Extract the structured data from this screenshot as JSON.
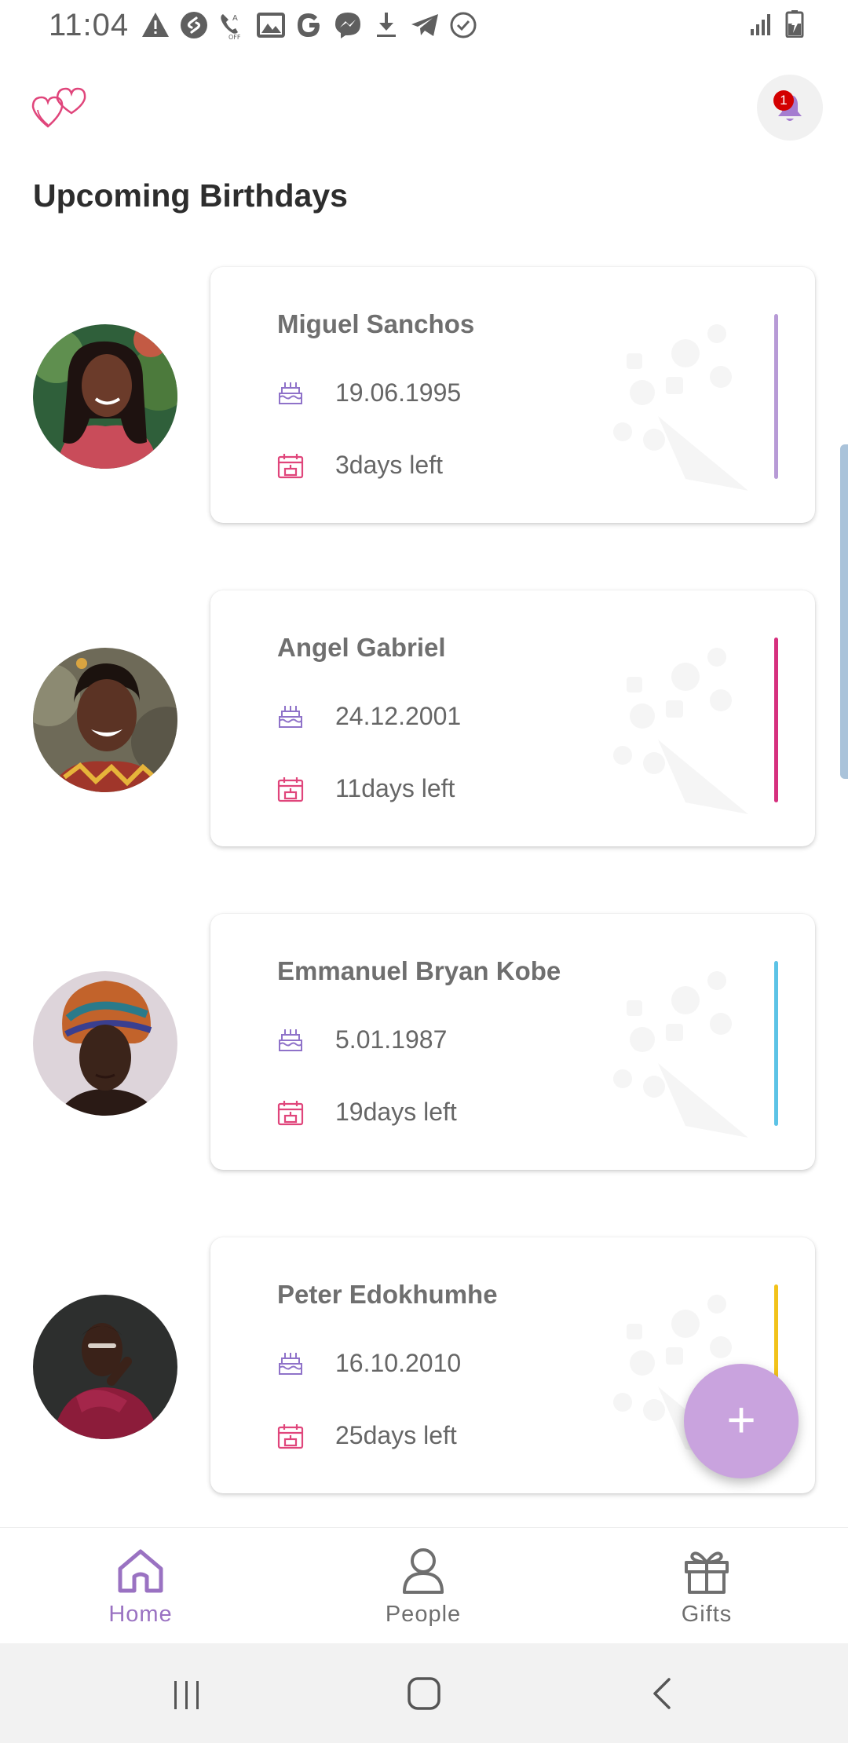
{
  "status_bar": {
    "time": "11:04",
    "left_icons": [
      "warning-icon",
      "shazam-icon",
      "wifi-calling-off-icon",
      "gallery-icon",
      "google-icon",
      "messenger-icon",
      "download-icon",
      "telegram-icon",
      "check-circle-icon"
    ],
    "right_icons": [
      "signal-icon",
      "battery-charging-icon"
    ]
  },
  "header": {
    "logo_icon": "hearts-logo-icon",
    "notification_icon": "bell-icon",
    "notification_count": "1"
  },
  "page": {
    "title": "Upcoming Birthdays"
  },
  "birthdays": [
    {
      "name": "Miguel Sanchos",
      "date": "19.06.1995",
      "days_left": "3days left",
      "accent_color": "#b79ad6"
    },
    {
      "name": "Angel Gabriel",
      "date": "24.12.2001",
      "days_left": "11days left",
      "accent_color": "#d6307e"
    },
    {
      "name": "Emmanuel Bryan Kobe",
      "date": "5.01.1987",
      "days_left": "19days left",
      "accent_color": "#5cc3e6"
    },
    {
      "name": "Peter Edokhumhe",
      "date": "16.10.2010",
      "days_left": "25days left",
      "accent_color": "#f2c21a"
    }
  ],
  "fab": {
    "label": "+"
  },
  "bottom_nav": {
    "items": [
      {
        "label": "Home",
        "icon": "home-icon",
        "active": true
      },
      {
        "label": "People",
        "icon": "person-icon",
        "active": false
      },
      {
        "label": "Gifts",
        "icon": "gift-icon",
        "active": false
      }
    ]
  },
  "system_nav": [
    "recents-icon",
    "home-circle-icon",
    "back-icon"
  ],
  "colors": {
    "accent_purple": "#9a72c2",
    "fab": "#c9a3de",
    "pink": "#e0457b",
    "badge_red": "#d30000"
  }
}
